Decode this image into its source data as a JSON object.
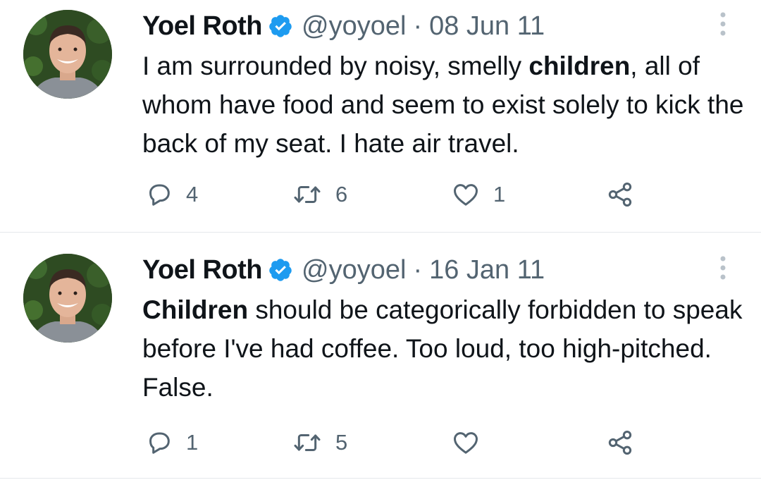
{
  "tweets": [
    {
      "author_name": "Yoel Roth",
      "handle": "@yoyoel",
      "separator": "·",
      "date": "08 Jun 11",
      "text_before": "I am surrounded by noisy, smelly ",
      "text_bold": "children",
      "text_after": ", all of whom have food and seem to exist solely to kick the back of my seat. I hate air travel.",
      "reply_count": "4",
      "retweet_count": "6",
      "like_count": "1"
    },
    {
      "author_name": "Yoel Roth",
      "handle": "@yoyoel",
      "separator": "·",
      "date": "16 Jan 11",
      "text_before": "",
      "text_bold": "Children",
      "text_after": " should be categorically forbidden to speak before I've had coffee. Too loud, too high-pitched. False.",
      "reply_count": "1",
      "retweet_count": "5",
      "like_count": ""
    }
  ],
  "icons": {
    "verified": "verified-badge-icon",
    "more": "more-vertical-icon",
    "reply": "reply-icon",
    "retweet": "retweet-icon",
    "like": "heart-icon",
    "share": "share-icon"
  },
  "colors": {
    "text": "#0f1419",
    "secondary": "#536471",
    "verified": "#1d9bf0",
    "divider": "#e5e8eb"
  }
}
